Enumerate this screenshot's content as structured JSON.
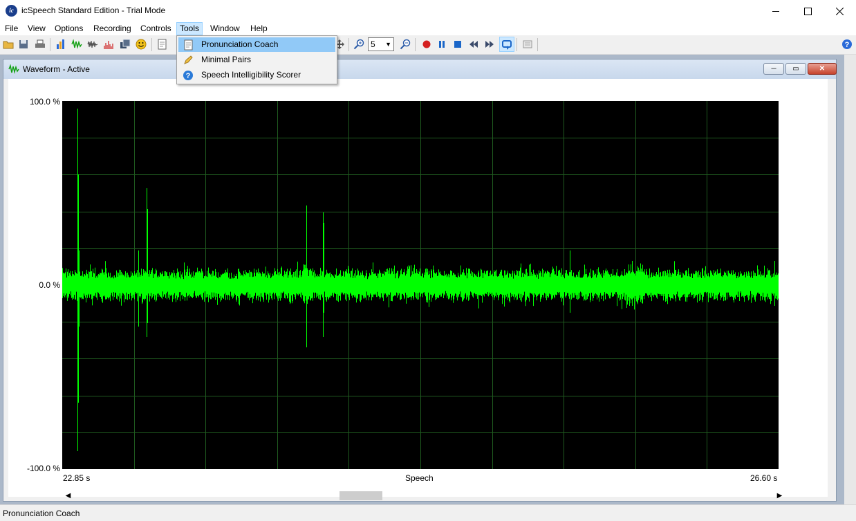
{
  "window": {
    "title": "icSpeech Standard Edition - Trial Mode",
    "logo_text": "ic",
    "controls": [
      "minimize-icon",
      "maximize-icon",
      "close-icon"
    ]
  },
  "menubar": {
    "items": [
      "File",
      "View",
      "Options",
      "Recording",
      "Controls",
      "Tools",
      "Window",
      "Help"
    ],
    "open": "Tools"
  },
  "toolbar": {
    "zoom_value": "5",
    "icons": [
      "open-icon",
      "save-icon",
      "print-icon",
      "bar-chart-icon",
      "waveform-icon",
      "spectrum-icon",
      "histogram-icon",
      "save-all-icon",
      "smiley-icon",
      "notebook-icon",
      "pan-icon",
      "zoom-in-icon",
      "zoom-out-icon",
      "record-icon",
      "pause-icon",
      "stop-icon",
      "rewind-icon",
      "fast-forward-icon",
      "loop-icon",
      "notes-icon",
      "help-icon"
    ]
  },
  "tools_menu": {
    "items": [
      {
        "label": "Pronunciation Coach",
        "icon": "notebook-icon",
        "selected": true
      },
      {
        "label": "Minimal Pairs",
        "icon": "pencil-icon",
        "selected": false
      },
      {
        "label": "Speech Intelligibility Scorer",
        "icon": "question-icon",
        "selected": false
      }
    ]
  },
  "child_window": {
    "title": "Waveform - Active",
    "buttons": [
      "minimize-icon",
      "restore-icon",
      "close-icon"
    ]
  },
  "plot": {
    "y_top": "100.0 %",
    "y_mid": "0.0 %",
    "y_bottom": "-100.0 %",
    "x_start": "22.85 s",
    "x_center": "Speech",
    "x_end": "26.60 s",
    "wave_color": "#00ff00",
    "grid_color": "#1f5a1f",
    "background": "#000000"
  },
  "status": {
    "text": "Pronunciation Coach"
  }
}
